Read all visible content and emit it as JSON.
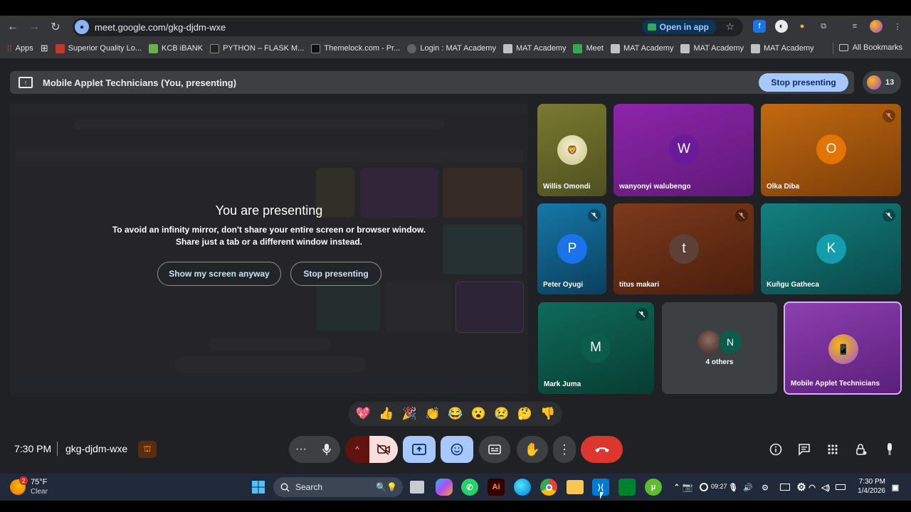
{
  "browser": {
    "url": "meet.google.com/gkg-djdm-wxe",
    "open_in_app": "Open in app",
    "bookmarks": [
      "Apps",
      "Superior Quality Lo...",
      "KCB iBANK",
      "PYTHON – FLASK M...",
      "Themelock.com - Pr...",
      "Login : MAT Academy",
      "MAT Academy",
      "Meet",
      "MAT Academy",
      "MAT Academy",
      "MAT Academy"
    ],
    "all_bookmarks": "All Bookmarks"
  },
  "presenting_bar": {
    "title": "Mobile Applet Technicians (You, presenting)",
    "stop_button": "Stop presenting",
    "people_count": "13"
  },
  "preview": {
    "heading": "You are presenting",
    "message_line1": "To avoid an infinity mirror, don't share your entire screen or browser window.",
    "message_line2": "Share just a tab or a different window instead.",
    "show_anyway": "Show my screen anyway",
    "stop": "Stop presenting"
  },
  "participants": [
    {
      "name": "Willis Omondi",
      "initial": "",
      "color": "#6b6b2a",
      "muted": false
    },
    {
      "name": "wanyonyi walubengo",
      "initial": "W",
      "color": "#7b1fa2",
      "muted": false
    },
    {
      "name": "Olka Diba",
      "initial": "O",
      "color": "#b24f0b",
      "muted": true
    },
    {
      "name": "Peter Oyugi",
      "initial": "P",
      "color": "#0b5c8a",
      "muted": true
    },
    {
      "name": "titus makari",
      "initial": "t",
      "color": "#6b3217",
      "muted": true
    },
    {
      "name": "Kuñgu Gatheca",
      "initial": "K",
      "color": "#0f6b6b",
      "muted": true
    },
    {
      "name": "Mark Juma",
      "initial": "M",
      "color": "#0d5c4f",
      "muted": true
    },
    {
      "name": "4 others",
      "initial": "N",
      "color": "#3c4043",
      "muted": false
    },
    {
      "name": "Mobile Applet Technicians",
      "initial": "",
      "color": "#7b2fa5",
      "muted": false
    }
  ],
  "reactions": [
    "💖",
    "👍",
    "🎉",
    "👏",
    "😂",
    "😮",
    "😢",
    "🤔",
    "👎"
  ],
  "meeting": {
    "time": "7:30 PM",
    "code": "gkg-djdm-wxe"
  },
  "taskbar": {
    "weather_temp": "75°F",
    "weather_cond": "Clear",
    "weather_badge": "2",
    "search": "Search",
    "tray_small_time": "09:27",
    "clock_time": "7:30 PM",
    "clock_date": "1/4/2026"
  }
}
